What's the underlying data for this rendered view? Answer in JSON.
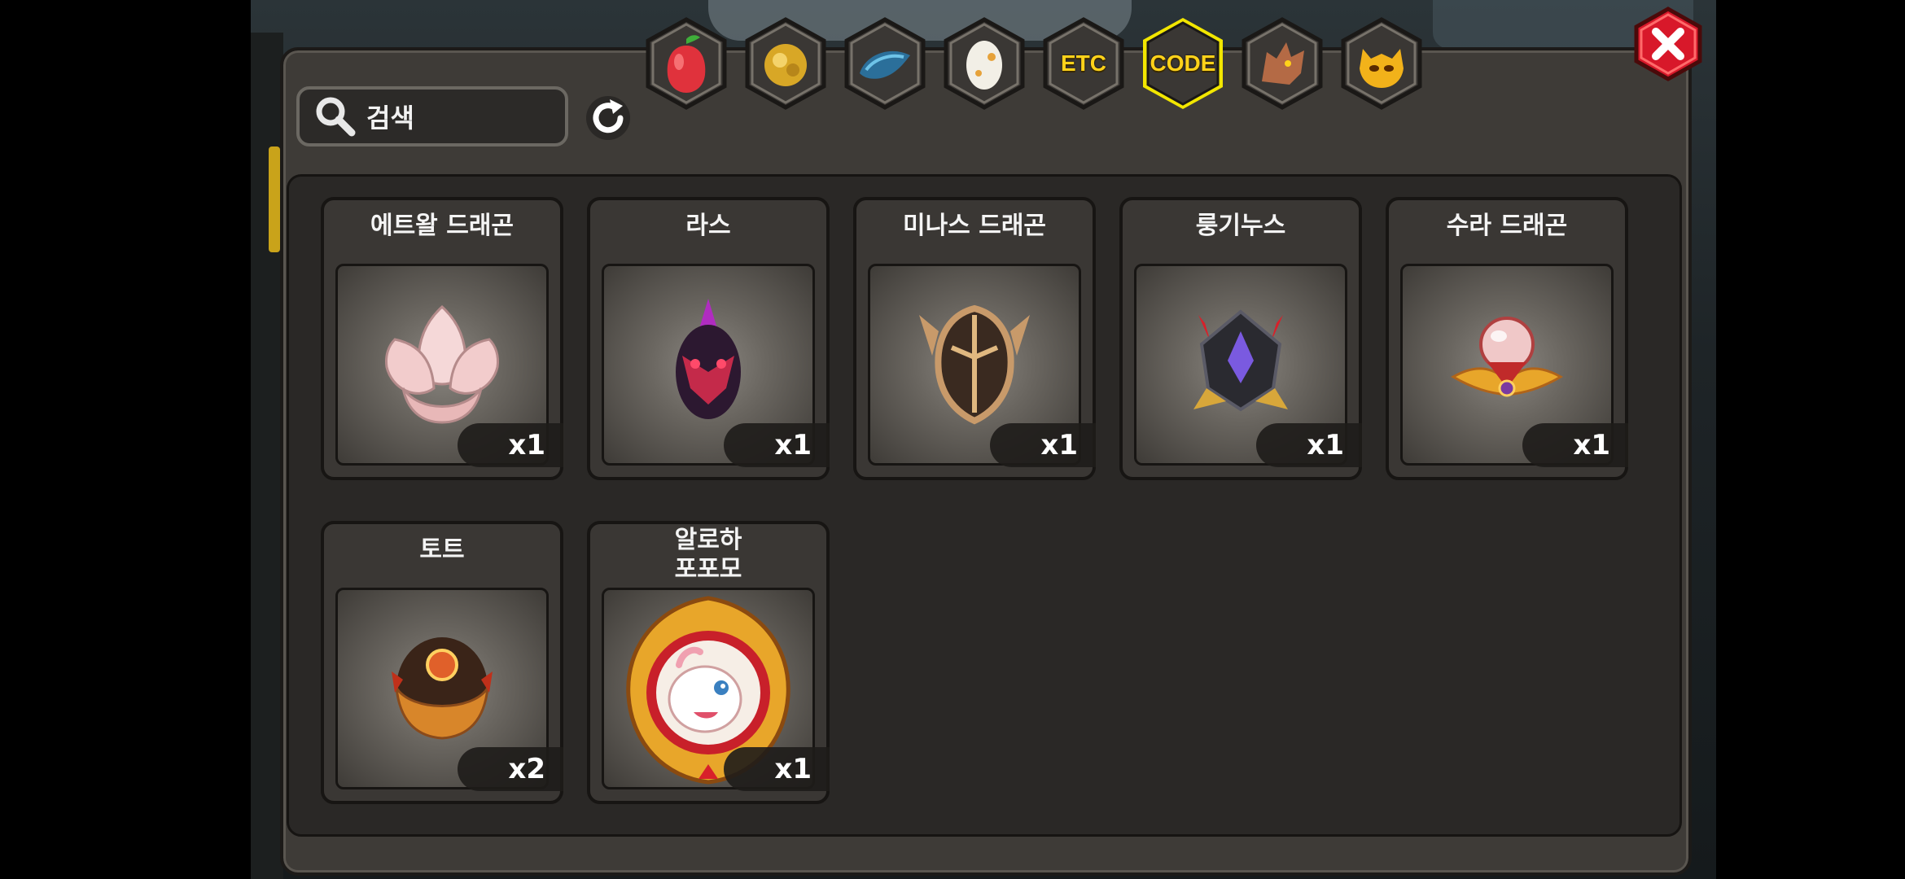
{
  "search": {
    "label": "검색"
  },
  "tabs": [
    {
      "icon": "fruit-icon",
      "label": ""
    },
    {
      "icon": "gold-nugget-icon",
      "label": ""
    },
    {
      "icon": "blue-scale-icon",
      "label": ""
    },
    {
      "icon": "egg-icon",
      "label": ""
    },
    {
      "icon": "etc-icon",
      "label": "ETC"
    },
    {
      "icon": "code-icon",
      "label": "CODE",
      "selected": true
    },
    {
      "icon": "dragon-head-icon",
      "label": ""
    },
    {
      "icon": "mask-icon",
      "label": ""
    }
  ],
  "items": [
    {
      "name": "에트왈 드래곤",
      "qty": "x1",
      "icon": "lotus-egg-icon"
    },
    {
      "name": "라스",
      "qty": "x1",
      "icon": "dark-spiked-egg-icon"
    },
    {
      "name": "미나스 드래곤",
      "qty": "x1",
      "icon": "bronze-helm-egg-icon"
    },
    {
      "name": "룽기누스",
      "qty": "x1",
      "icon": "crystal-crown-egg-icon"
    },
    {
      "name": "수라 드래곤",
      "qty": "x1",
      "icon": "pearl-winged-egg-icon"
    },
    {
      "name": "토트",
      "qty": "x2",
      "icon": "orange-orb-egg-icon"
    },
    {
      "name": "알로하\n포포모",
      "qty": "x1",
      "icon": "pink-dragon-portrait-icon"
    }
  ],
  "colors": {
    "selected_tab_border": "#f2e600",
    "close_button": "#d8182a",
    "tab_label": "#ffd21a"
  }
}
